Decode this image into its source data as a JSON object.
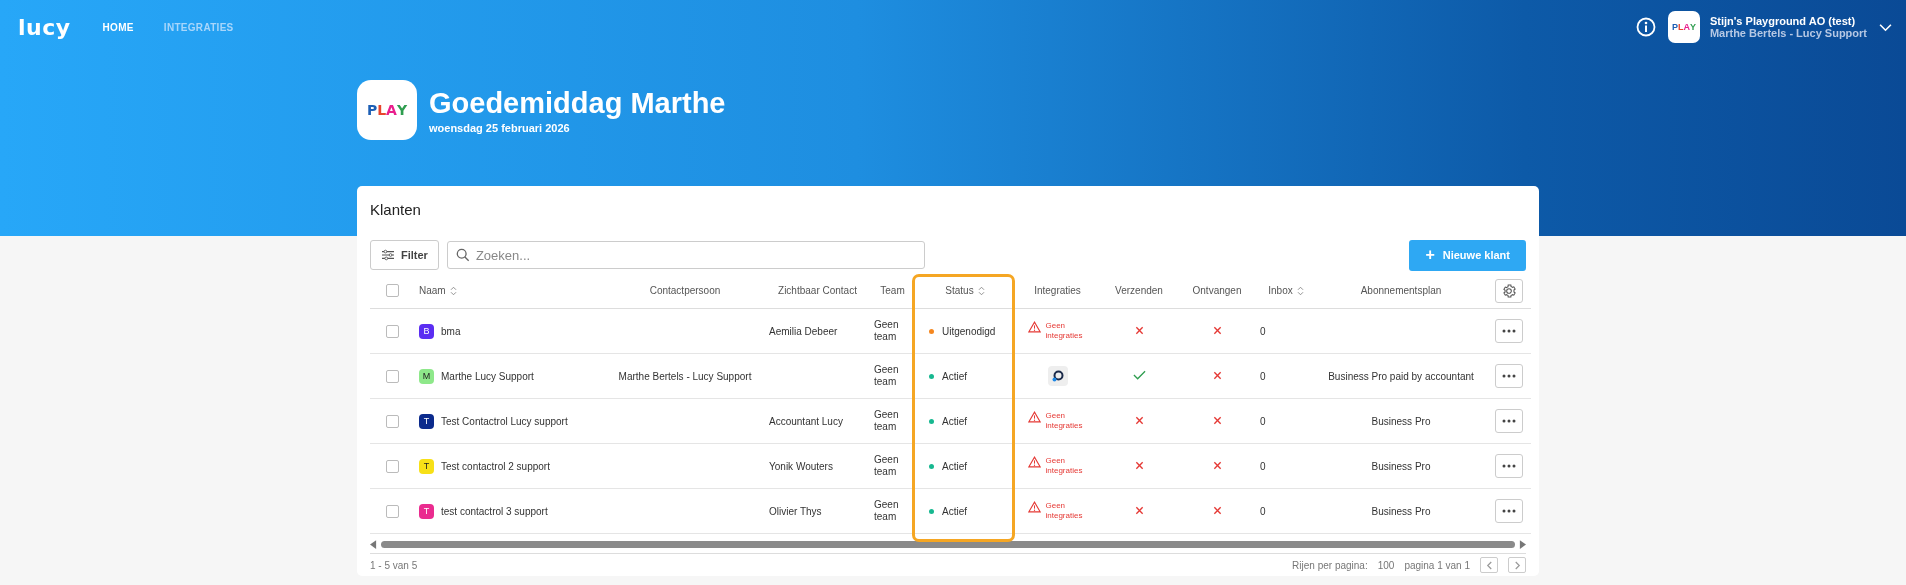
{
  "nav": {
    "logo": "lucy",
    "items": [
      {
        "label": "HOME",
        "selected": true
      },
      {
        "label": "INTEGRATIES",
        "selected": false
      }
    ]
  },
  "account": {
    "avatar_text": "PLAY",
    "name": "Stijn's Playground AO (test)",
    "user": "Marthe Bertels - Lucy Support"
  },
  "greeting": {
    "logo_text": "PLAY",
    "title": "Goedemiddag Marthe",
    "date": "woensdag 25 februari 2026"
  },
  "card": {
    "title": "Klanten",
    "filter": "Filter",
    "search_placeholder": "Zoeken...",
    "new_button": "Nieuwe klant",
    "new_icon": "+"
  },
  "table": {
    "all_selected": false,
    "columns": [
      {
        "label": "Naam",
        "sortable": true
      },
      {
        "label": "Contactpersoon",
        "sortable": false
      },
      {
        "label": "Zichtbaar Contact",
        "sortable": false
      },
      {
        "label": "Team",
        "sortable": false
      },
      {
        "label": "Status",
        "sortable": true,
        "highlighted": true
      },
      {
        "label": "Integraties",
        "sortable": false
      },
      {
        "label": "Verzenden",
        "sortable": false
      },
      {
        "label": "Ontvangen",
        "sortable": false
      },
      {
        "label": "Inbox",
        "sortable": true
      },
      {
        "label": "Abonnementsplan",
        "sortable": false
      }
    ],
    "rows": [
      {
        "selected": false,
        "initial": "B",
        "color": "#5b2df2",
        "name": "bma",
        "contact": "",
        "visible_contact": "Aemilia Debeer",
        "team": "Geen team",
        "status": {
          "label": "Uitgenodigd",
          "color": "#f5871f"
        },
        "integrations": {
          "kind": "none",
          "label": "Geen integraties"
        },
        "sending": false,
        "receiving": false,
        "inbox": "0",
        "plan": ""
      },
      {
        "selected": false,
        "initial": "M",
        "color": "#8ee88a",
        "name": "Marthe Lucy Support",
        "contact": "Marthe Bertels - Lucy Support",
        "visible_contact": "",
        "team": "Geen team",
        "status": {
          "label": "Actief",
          "color": "#17b890"
        },
        "integrations": {
          "kind": "app"
        },
        "sending": true,
        "receiving": false,
        "inbox": "0",
        "plan": "Business Pro paid by accountant"
      },
      {
        "selected": false,
        "initial": "T",
        "color": "#0b2a8c",
        "name": "Test Contactrol Lucy support",
        "contact": "",
        "visible_contact": "Accountant Lucy",
        "team": "Geen team",
        "status": {
          "label": "Actief",
          "color": "#17b890"
        },
        "integrations": {
          "kind": "none",
          "label": "Geen integraties"
        },
        "sending": false,
        "receiving": false,
        "inbox": "0",
        "plan": "Business Pro"
      },
      {
        "selected": false,
        "initial": "T",
        "color": "#f7e017",
        "name": "Test contactrol 2 support",
        "contact": "",
        "visible_contact": "Yonik Wouters",
        "team": "Geen team",
        "status": {
          "label": "Actief",
          "color": "#17b890"
        },
        "integrations": {
          "kind": "none",
          "label": "Geen integraties"
        },
        "sending": false,
        "receiving": false,
        "inbox": "0",
        "plan": "Business Pro"
      },
      {
        "selected": false,
        "initial": "T",
        "color": "#ea2b8f",
        "name": "test contactrol 3 support",
        "contact": "",
        "visible_contact": "Olivier Thys",
        "team": "Geen team",
        "status": {
          "label": "Actief",
          "color": "#17b890"
        },
        "integrations": {
          "kind": "none",
          "label": "Geen integraties"
        },
        "sending": false,
        "receiving": false,
        "inbox": "0",
        "plan": "Business Pro"
      }
    ]
  },
  "footer": {
    "range": "1 - 5 van 5",
    "rows_label": "Rijen per pagina:",
    "rows_value": "100",
    "page": "pagina 1 van 1"
  }
}
